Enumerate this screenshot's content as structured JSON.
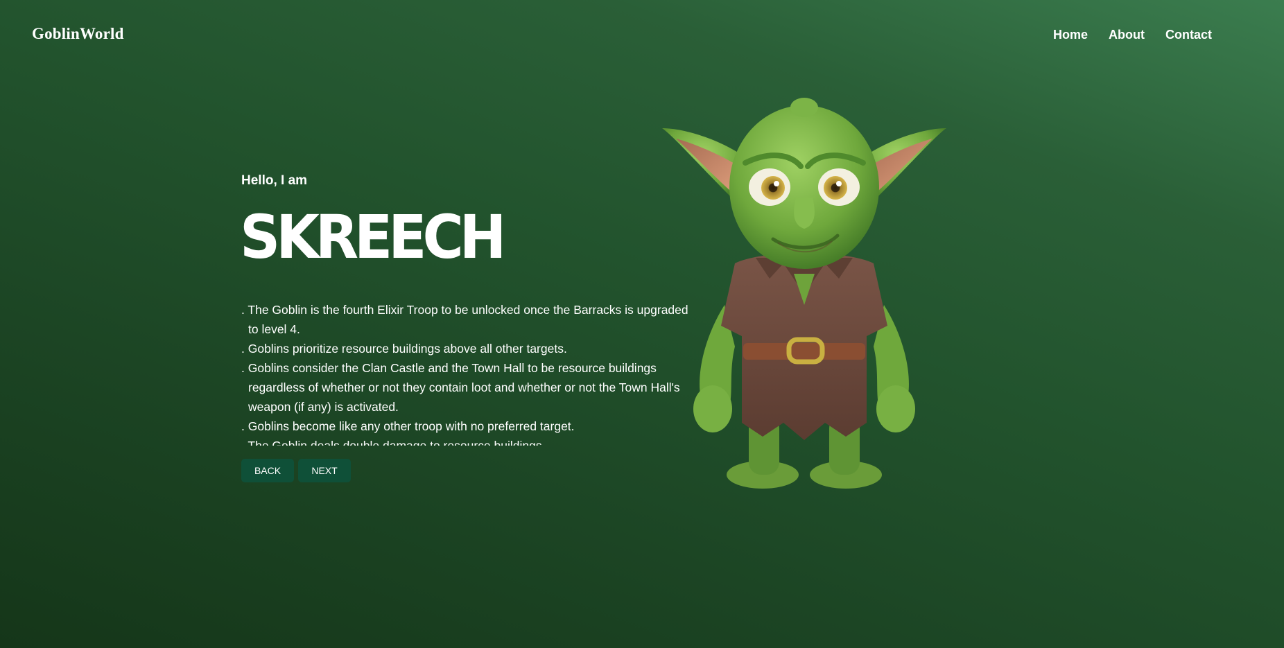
{
  "header": {
    "logo": "GoblinWorld",
    "nav": [
      {
        "label": "Home"
      },
      {
        "label": "About"
      },
      {
        "label": "Contact"
      }
    ]
  },
  "hero": {
    "greeting": "Hello, I am",
    "name": "SKREECH",
    "facts": [
      ". The Goblin is the fourth Elixir Troop to be unlocked once the Barracks is upgraded to level 4.",
      ". Goblins prioritize resource buildings above all other targets.",
      ". Goblins consider the Clan Castle and the Town Hall to be resource buildings regardless of whether or not they contain loot and whether or not the Town Hall's weapon (if any) is activated.",
      ". Goblins become like any other troop with no preferred target.",
      ". The Goblin deals double damage to resource buildings."
    ],
    "buttons": {
      "back": "BACK",
      "next": "NEXT"
    }
  },
  "image": {
    "icon": "goblin-character-illustration"
  }
}
